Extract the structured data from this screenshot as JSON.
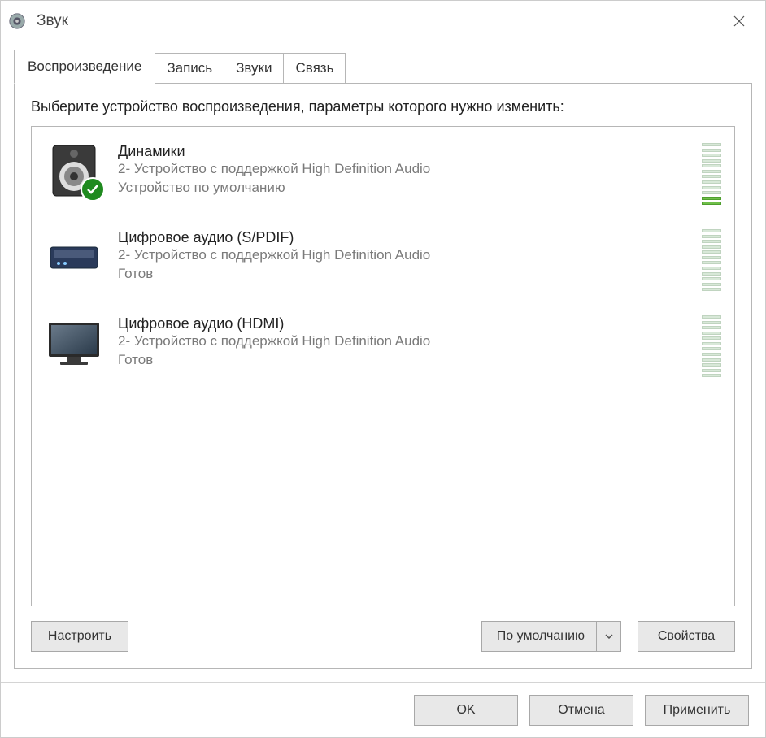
{
  "window": {
    "title": "Звук"
  },
  "tabs": [
    {
      "label": "Воспроизведение"
    },
    {
      "label": "Запись"
    },
    {
      "label": "Звуки"
    },
    {
      "label": "Связь"
    }
  ],
  "instruction": "Выберите устройство воспроизведения, параметры которого нужно изменить:",
  "devices": [
    {
      "name": "Динамики",
      "sub": "2- Устройство с поддержкой High Definition Audio",
      "status": "Устройство по умолчанию",
      "icon": "speaker",
      "default": true,
      "level": 2
    },
    {
      "name": "Цифровое аудио (S/PDIF)",
      "sub": "2- Устройство с поддержкой High Definition Audio",
      "status": "Готов",
      "icon": "spdif",
      "default": false,
      "level": 0
    },
    {
      "name": "Цифровое аудио (HDMI)",
      "sub": "2- Устройство с поддержкой High Definition Audio",
      "status": "Готов",
      "icon": "monitor",
      "default": false,
      "level": 0
    }
  ],
  "panelButtons": {
    "configure": "Настроить",
    "setDefault": "По умолчанию",
    "properties": "Свойства"
  },
  "footer": {
    "ok": "OK",
    "cancel": "Отмена",
    "apply": "Применить"
  }
}
